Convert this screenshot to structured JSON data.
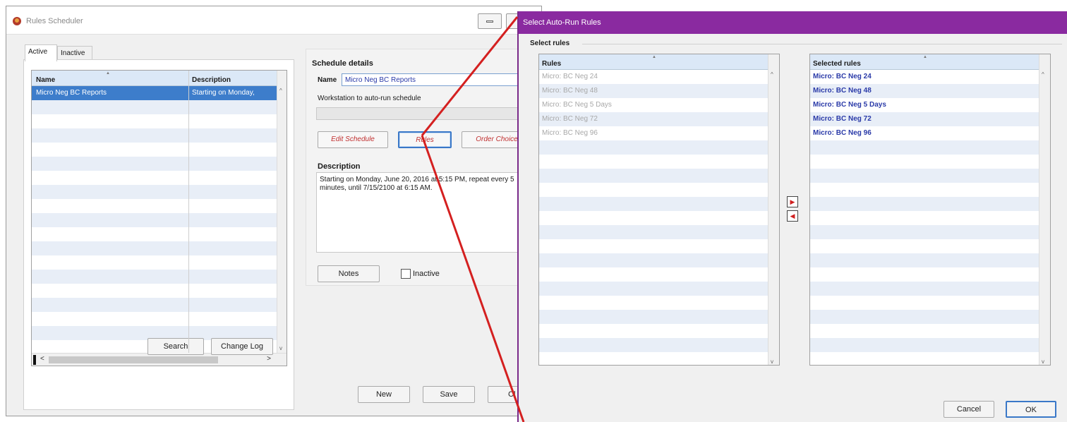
{
  "main_window": {
    "title": "Rules Scheduler",
    "tabs": [
      "Active",
      "Inactive"
    ],
    "schedule_table": {
      "columns": [
        "Name",
        "Description"
      ],
      "rows": [
        {
          "name": "Micro Neg BC Reports",
          "description": "Starting on Monday,"
        }
      ]
    },
    "buttons": {
      "search": "Search",
      "change_log": "Change Log",
      "new": "New",
      "save": "Save",
      "close": "Cl"
    },
    "schedule_details": {
      "title": "Schedule details",
      "name_label": "Name",
      "name_value": "Micro Neg BC Reports",
      "workstation_label": "Workstation to auto-run schedule",
      "edit_schedule": "Edit Schedule",
      "rules": "Rules",
      "order_choice": "Order Choice",
      "description_label": "Description",
      "description_text": "Starting on Monday, June 20, 2016 at 5:15 PM, repeat every 5 minutes, until 7/15/2100 at 6:15 AM.",
      "notes": "Notes",
      "inactive_label": "Inactive",
      "inactive_checked": false
    }
  },
  "dialog": {
    "title": "Select Auto-Run Rules",
    "section_title": "Select rules",
    "rules_header": "Rules",
    "rules": [
      "Micro: BC Neg 24",
      "Micro: BC Neg 48",
      "Micro: BC Neg 5 Days",
      "Micro: BC Neg 72",
      "Micro: BC Neg 96"
    ],
    "selected_header": "Selected rules",
    "selected_rules": [
      "Micro: BC Neg 24",
      "Micro: BC Neg 48",
      "Micro: BC Neg 5 Days",
      "Micro: BC Neg 72",
      "Micro: BC Neg 96"
    ],
    "cancel": "Cancel",
    "ok": "OK",
    "move_right_icon": "arrow-right-icon",
    "move_left_icon": "arrow-left-icon"
  },
  "colors": {
    "dialog_titlebar": "#8a2aa0",
    "annotation_line": "#d42020",
    "selected_row": "#3d7dcb",
    "header_bg": "#dbe8f7"
  }
}
